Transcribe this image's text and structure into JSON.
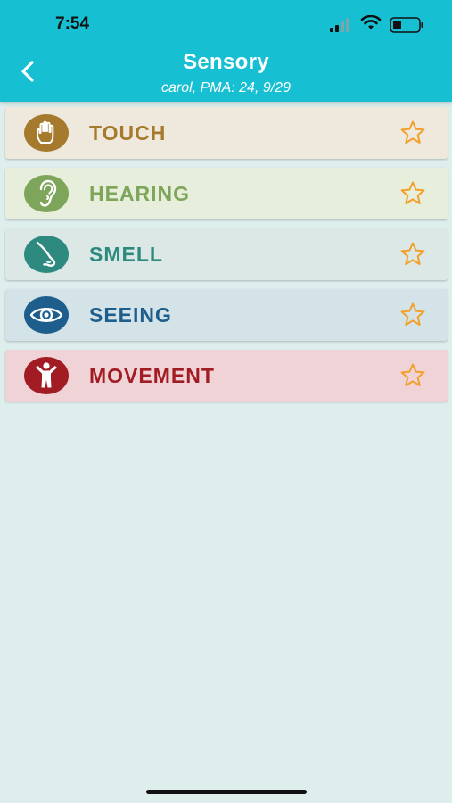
{
  "status_bar": {
    "time": "7:54"
  },
  "header": {
    "title": "Sensory",
    "subtitle": "carol, PMA: 24, 9/29",
    "background": "#16bfd2"
  },
  "star_color": "#f3a02a",
  "items": [
    {
      "label": "TOUCH",
      "icon": "hand-icon",
      "bg": "#efe9dd",
      "color": "#a57a2c"
    },
    {
      "label": "HEARING",
      "icon": "ear-icon",
      "bg": "#e8eedc",
      "color": "#7ea65a"
    },
    {
      "label": "SMELL",
      "icon": "nose-icon",
      "bg": "#dbe8e5",
      "color": "#2e8a7e"
    },
    {
      "label": "SEEING",
      "icon": "eye-icon",
      "bg": "#d3e3e7",
      "color": "#1e5e8c"
    },
    {
      "label": "MOVEMENT",
      "icon": "movement-icon",
      "bg": "#efd3d7",
      "color": "#a11d23"
    }
  ]
}
